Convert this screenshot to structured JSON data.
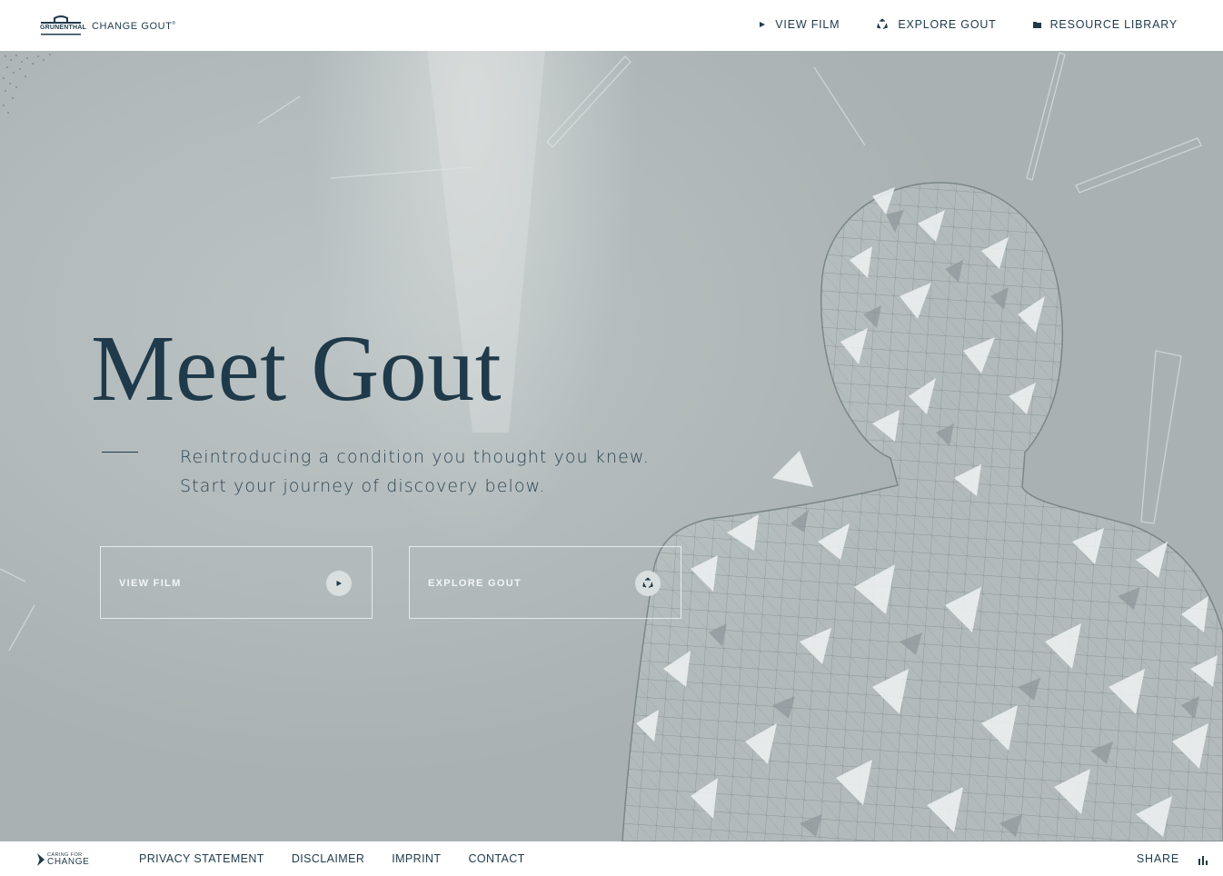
{
  "header": {
    "brand_logo": "GRUNENTHAL",
    "product_logo": "CHANGE GOUT",
    "nav": [
      {
        "label": "VIEW FILM",
        "icon": "play-icon"
      },
      {
        "label": "EXPLORE GOUT",
        "icon": "molecule-icon"
      },
      {
        "label": "RESOURCE LIBRARY",
        "icon": "folder-icon"
      }
    ]
  },
  "hero": {
    "title": "Meet Gout",
    "subtitle_line1": "Reintroducing a condition you thought you knew.",
    "subtitle_line2": "Start your journey of discovery below.",
    "cta": [
      {
        "label": "VIEW FILM",
        "icon": "play-icon"
      },
      {
        "label": "EXPLORE GOUT",
        "icon": "molecule-icon"
      }
    ]
  },
  "footer": {
    "logo_line1": "CARING FOR",
    "logo_line2": "CHANGE",
    "links": [
      "PRIVACY STATEMENT",
      "DISCLAIMER",
      "IMPRINT",
      "CONTACT"
    ],
    "share_label": "SHARE",
    "share_icon": "bar-chart-icon"
  },
  "colors": {
    "text_primary": "#1f3a4a",
    "hero_background": "#b4bcbd",
    "cta_border": "#f0f3f3",
    "header_background": "#ffffff"
  }
}
